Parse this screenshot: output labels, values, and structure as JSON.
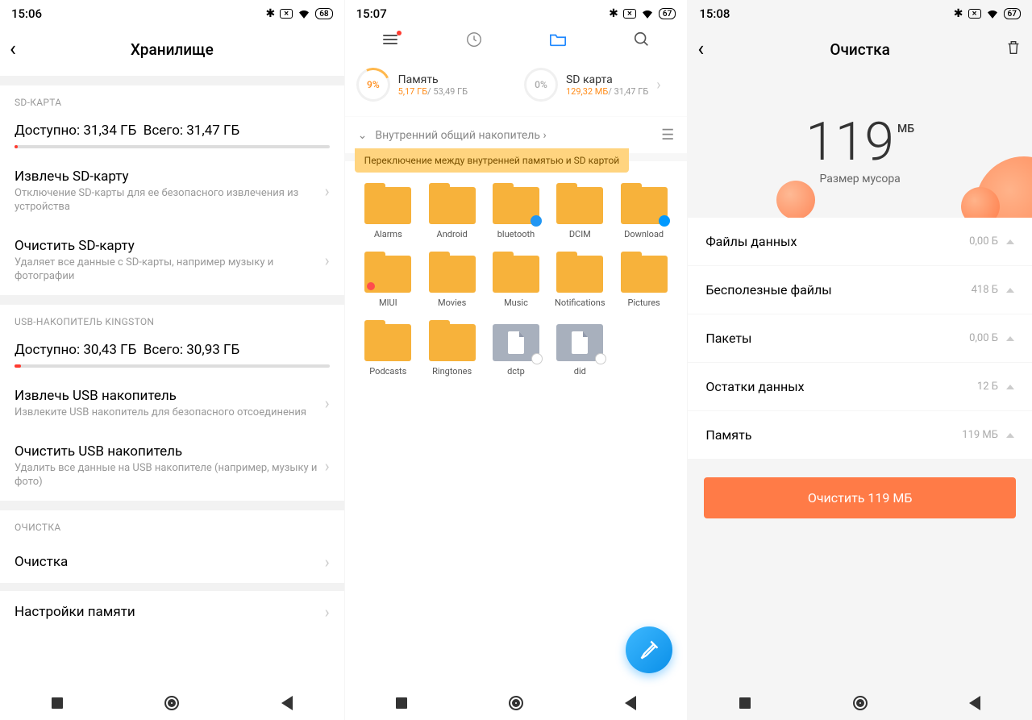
{
  "screen1": {
    "time": "15:06",
    "battery": "68",
    "title": "Хранилище",
    "sd": {
      "label": "SD-КАРТА",
      "avail_label": "Доступно: 31,34 ГБ",
      "total_label": "Всего: 31,47 ГБ",
      "fill_pct": 1,
      "eject_title": "Извлечь SD-карту",
      "eject_sub": "Отключение SD-карты для ее безопасного извлечения из устройства",
      "clear_title": "Очистить SD-карту",
      "clear_sub": "Удаляет все данные с SD-карты, например музыку и фотографии"
    },
    "usb": {
      "label": "USB-НАКОПИТЕЛЬ KINGSTON",
      "avail_label": "Доступно: 30,43 ГБ",
      "total_label": "Всего: 30,93 ГБ",
      "fill_pct": 2,
      "eject_title": "Извлечь USB накопитель",
      "eject_sub": "Извлеките USB накопитель для безопасного отсоединения",
      "clear_title": "Очистить USB накопитель",
      "clear_sub": "Удалить все данные на USB накопителе (например, музыку и фото)"
    },
    "clean_label": "ОЧИСТКА",
    "clean_item": "Очистка",
    "settings_item": "Настройки памяти"
  },
  "screen2": {
    "time": "15:07",
    "battery": "67",
    "mem": {
      "pct": "9%",
      "label": "Память",
      "used": "5,17 ГБ",
      "total": "/ 53,49 ГБ"
    },
    "sdc": {
      "pct": "0%",
      "label": "SD карта",
      "used": "129,32 МБ",
      "total": "/ 31,47 ГБ"
    },
    "breadcrumb": "Внутренний общий накопитель",
    "tooltip": "Переключение между внутренней памятью и SD картой",
    "folders": [
      {
        "name": "Alarms",
        "type": "folder"
      },
      {
        "name": "Android",
        "type": "folder"
      },
      {
        "name": "bluetooth",
        "type": "folder",
        "badge": "blue"
      },
      {
        "name": "DCIM",
        "type": "folder"
      },
      {
        "name": "Download",
        "type": "folder",
        "badge": "bd"
      },
      {
        "name": "MIUI",
        "type": "folder",
        "badge": "red"
      },
      {
        "name": "Movies",
        "type": "folder"
      },
      {
        "name": "Music",
        "type": "folder"
      },
      {
        "name": "Notifications",
        "type": "folder"
      },
      {
        "name": "Pictures",
        "type": "folder"
      },
      {
        "name": "Podcasts",
        "type": "folder"
      },
      {
        "name": "Ringtones",
        "type": "folder"
      },
      {
        "name": "dctp",
        "type": "file"
      },
      {
        "name": "did",
        "type": "file"
      }
    ]
  },
  "screen3": {
    "time": "15:08",
    "battery": "67",
    "title": "Очистка",
    "big_value": "119",
    "unit": "МБ",
    "sub": "Размер мусора",
    "cats": [
      {
        "name": "Файлы данных",
        "size": "0,00 Б"
      },
      {
        "name": "Бесполезные файлы",
        "size": "418 Б"
      },
      {
        "name": "Пакеты",
        "size": "0,00 Б"
      },
      {
        "name": "Остатки данных",
        "size": "12 Б"
      },
      {
        "name": "Память",
        "size": "119 МБ"
      }
    ],
    "button": "Очистить 119 МБ"
  }
}
